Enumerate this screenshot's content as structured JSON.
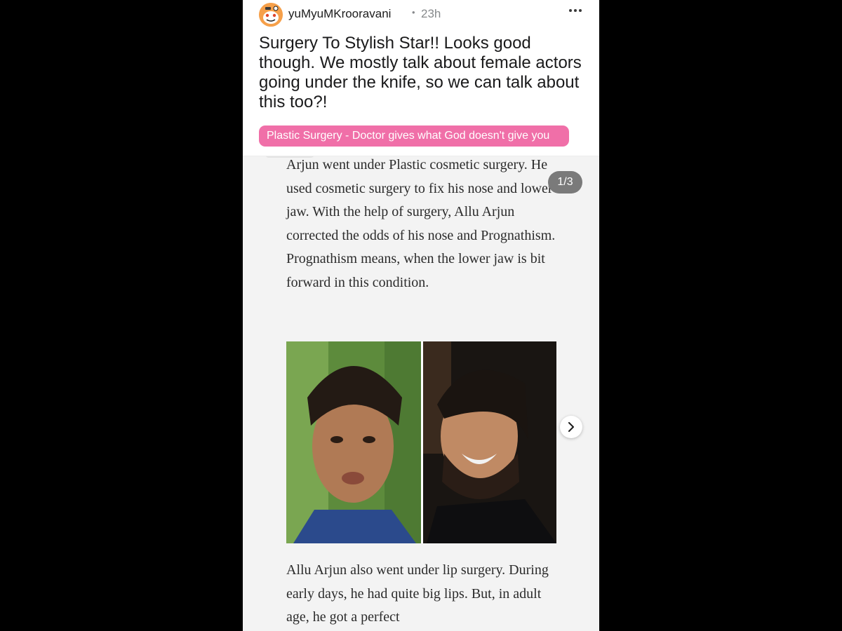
{
  "post": {
    "author": "yuMyuMKrooravani",
    "separator": "•",
    "time": "23h",
    "title": "Surgery To Stylish Star!! Looks good though. We mostly talk about female actors going under the knife, so we can talk about this too?!",
    "flair": "Plastic Surgery - Doctor gives what God doesn't give you"
  },
  "gallery": {
    "counter": "1/3",
    "paragraph_top": "Arjun went under Plastic cosmetic surgery. He used cosmetic surgery to fix his nose and lower jaw. With the help of surgery, Allu Arjun corrected the odds of his nose and Prognathism. Prognathism means, when the lower jaw is bit forward in this condition.",
    "paragraph_bottom": "Allu Arjun also went under lip surgery. During early days, he had quite big lips. But, in adult age, he got a perfect"
  },
  "icons": {
    "avatar": "snoo-avatar-icon",
    "more": "more-options-icon",
    "next": "chevron-right-icon"
  },
  "colors": {
    "flair_bg": "#f06fa8",
    "counter_bg": "#7a7a7a",
    "page_bg": "#000000"
  }
}
